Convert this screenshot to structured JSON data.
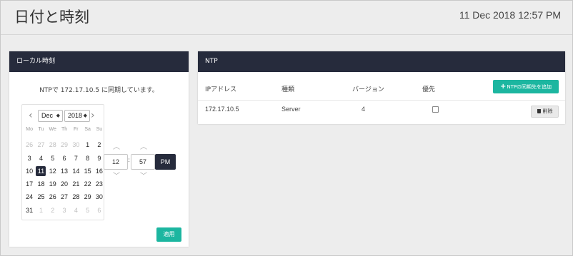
{
  "header": {
    "title": "日付と時刻",
    "datetime": "11 Dec 2018 12:57 PM"
  },
  "local_panel": {
    "title": "ローカル時刻",
    "sync_text": "NTPで 172.17.10.5 に同期しています。",
    "calendar": {
      "month": "Dec",
      "year": "2018",
      "weekdays": [
        "Mo",
        "Tu",
        "We",
        "Th",
        "Fr",
        "Sa",
        "Su"
      ],
      "days": [
        {
          "d": "26",
          "muted": true
        },
        {
          "d": "27",
          "muted": true
        },
        {
          "d": "28",
          "muted": true
        },
        {
          "d": "29",
          "muted": true
        },
        {
          "d": "30",
          "muted": true
        },
        {
          "d": "1"
        },
        {
          "d": "2"
        },
        {
          "d": "3"
        },
        {
          "d": "4"
        },
        {
          "d": "5"
        },
        {
          "d": "6"
        },
        {
          "d": "7"
        },
        {
          "d": "8"
        },
        {
          "d": "9"
        },
        {
          "d": "10"
        },
        {
          "d": "11",
          "selected": true
        },
        {
          "d": "12"
        },
        {
          "d": "13"
        },
        {
          "d": "14"
        },
        {
          "d": "15"
        },
        {
          "d": "16"
        },
        {
          "d": "17"
        },
        {
          "d": "18"
        },
        {
          "d": "19"
        },
        {
          "d": "20"
        },
        {
          "d": "21"
        },
        {
          "d": "22"
        },
        {
          "d": "23"
        },
        {
          "d": "24"
        },
        {
          "d": "25"
        },
        {
          "d": "26"
        },
        {
          "d": "27"
        },
        {
          "d": "28"
        },
        {
          "d": "29"
        },
        {
          "d": "30"
        },
        {
          "d": "31"
        },
        {
          "d": "1",
          "muted": true
        },
        {
          "d": "2",
          "muted": true
        },
        {
          "d": "3",
          "muted": true
        },
        {
          "d": "4",
          "muted": true
        },
        {
          "d": "5",
          "muted": true
        },
        {
          "d": "6",
          "muted": true
        }
      ]
    },
    "time": {
      "hour": "12",
      "minute": "57",
      "ampm": "PM"
    },
    "apply_label": "適用"
  },
  "ntp_panel": {
    "title": "NTP",
    "add_label": "NTPの同期先を追加",
    "columns": [
      "IPアドレス",
      "種類",
      "バージョン",
      "優先"
    ],
    "rows": [
      {
        "ip": "172.17.10.5",
        "type": "Server",
        "version": "4",
        "preferred": false,
        "delete_label": "削除"
      }
    ]
  },
  "colors": {
    "panel_header": "#262b3c",
    "accent": "#1cb6a0",
    "background": "#ededed"
  }
}
